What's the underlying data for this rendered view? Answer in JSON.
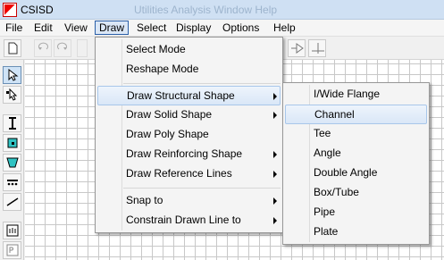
{
  "window": {
    "title": "CSISD",
    "ghost_menu": "Utilities   Analysis   Window   Help"
  },
  "menubar": {
    "items": [
      "File",
      "Edit",
      "View",
      "Draw",
      "Select",
      "Display",
      "Options",
      "Help"
    ],
    "active": "Draw"
  },
  "draw_menu": {
    "items": [
      {
        "label": "Select Mode",
        "submenu": false
      },
      {
        "label": "Reshape Mode",
        "submenu": false
      },
      {
        "label": "Draw Structural Shape",
        "submenu": true
      },
      {
        "label": "Draw Solid Shape",
        "submenu": true
      },
      {
        "label": "Draw Poly Shape",
        "submenu": false
      },
      {
        "label": "Draw Reinforcing Shape",
        "submenu": true
      },
      {
        "label": "Draw Reference Lines",
        "submenu": true
      },
      {
        "label": "Snap to",
        "submenu": true
      },
      {
        "label": "Constrain Drawn Line to",
        "submenu": true
      }
    ],
    "highlighted": "Draw Structural Shape"
  },
  "structural_submenu": {
    "items": [
      "I/Wide Flange",
      "Channel",
      "Tee",
      "Angle",
      "Double Angle",
      "Box/Tube",
      "Pipe",
      "Plate"
    ],
    "highlighted": "Channel"
  },
  "colors": {
    "titlebar": "#cfe0f3",
    "highlight_border": "#a8c7ea",
    "grid": "#c8c8c8"
  },
  "icons": {
    "toolbar": [
      "new-document-icon",
      "undo-icon",
      "redo-icon",
      "polygon-icon",
      "axis-icon"
    ],
    "leftbar": [
      "pointer-icon",
      "reshape-icon",
      "i-section-icon",
      "solid-shape-icon",
      "poly-shape-icon",
      "reinforcing-icon",
      "reference-line-icon",
      "all-icon",
      "ps-icon"
    ]
  }
}
